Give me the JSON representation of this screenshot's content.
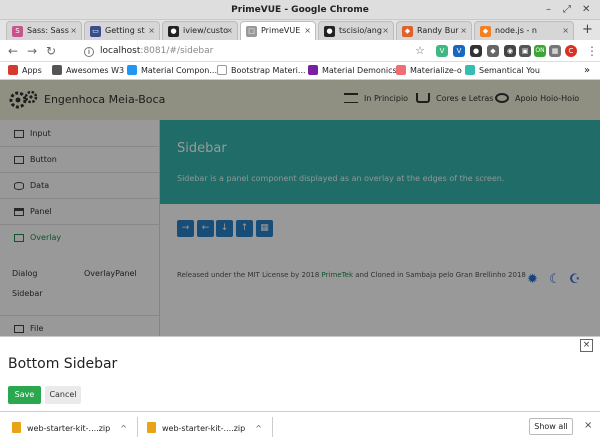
{
  "window": {
    "title": "PrimeVUE - Google Chrome",
    "minimize": "–",
    "maximize": "⤢",
    "close": "✕"
  },
  "tabs": [
    {
      "label": "Sass: Sass",
      "favicon_text": "S",
      "favicon_color": "#c6538c"
    },
    {
      "label": "Getting st",
      "favicon_text": "▭",
      "favicon_color": "#3b4c8a"
    },
    {
      "label": "iview/custo",
      "favicon_text": "●",
      "favicon_color": "#222222"
    },
    {
      "label": "PrimeVUE",
      "favicon_text": "□",
      "favicon_color": "#999999"
    },
    {
      "label": "tscisio/ang",
      "favicon_text": "●",
      "favicon_color": "#222222"
    },
    {
      "label": "Randy Bur",
      "favicon_text": "◆",
      "favicon_color": "#e0612b"
    },
    {
      "label": "node.js - n",
      "favicon_text": "◆",
      "favicon_color": "#f48024"
    }
  ],
  "tab_close": "×",
  "new_tab": "+",
  "toolbar": {
    "back": "←",
    "forward": "→",
    "reload": "↻",
    "url_host": "localhost",
    "url_rest": ":8081/#/sidebar",
    "star": "☆",
    "extensions": [
      {
        "name": "vue-devtools-icon",
        "text": "V",
        "color": "#41b883"
      },
      {
        "name": "vuetify-icon",
        "text": "V",
        "color": "#1867c0"
      },
      {
        "name": "github-ext-icon",
        "text": "●",
        "color": "#333333"
      },
      {
        "name": "puzzle-ext-icon",
        "text": "◆",
        "color": "#666666"
      },
      {
        "name": "circle-ext-icon",
        "text": "◉",
        "color": "#444444"
      },
      {
        "name": "camera-ext-icon",
        "text": "▣",
        "color": "#555555"
      },
      {
        "name": "green-ext-icon",
        "text": "ON",
        "color": "#3aa635"
      },
      {
        "name": "grid-ext-icon",
        "text": "▦",
        "color": "#777777"
      },
      {
        "name": "profile-avatar-icon",
        "text": "C",
        "color": "#d93025"
      }
    ],
    "menu": "⋮"
  },
  "bookmarks": [
    {
      "label": "Apps",
      "color": "#d33b2c"
    },
    {
      "label": "Awesomes W3",
      "color": "#555555"
    },
    {
      "label": "Material Compon...",
      "color": "#2196f3"
    },
    {
      "label": "Bootstrap Materi...",
      "color": "#cccccc"
    },
    {
      "label": "Material Demonics",
      "color": "#7b1fa2"
    },
    {
      "label": "Materialize-o",
      "color": "#ee6e73"
    },
    {
      "label": "Semantical You",
      "color": "#35bdb2"
    }
  ],
  "bookmarks_more": "»",
  "app": {
    "brand": "Engenhoca Meia-Boca",
    "menu": [
      "In Principio",
      "Cores e Letras",
      "Apoio Hoio-Hoio"
    ]
  },
  "sidemenu": {
    "items": [
      "Input",
      "Button",
      "Data",
      "Panel",
      "Overlay"
    ],
    "sub": [
      "Dialog",
      "OverlayPanel",
      "Sidebar"
    ],
    "file": "File"
  },
  "hero": {
    "title": "Sidebar",
    "desc": "Sidebar is a panel component displayed as an overlay at the edges of the screen."
  },
  "buttons": [
    "→",
    "←",
    "↓",
    "↑",
    "▦"
  ],
  "license": {
    "pre": "Released under the MIT License by 2018 ",
    "link": "PrimeTek",
    "post": " and Cloned in Sambaja pelo Gran Brellinho 2018"
  },
  "theme_icons": [
    "✹",
    "☾",
    "☪"
  ],
  "bottom_sidebar": {
    "close": "×",
    "title": "Bottom Sidebar",
    "save": "Save",
    "cancel": "Cancel"
  },
  "downloads": [
    {
      "label": "web-starter-kit-....zip",
      "chev": "^"
    },
    {
      "label": "web-starter-kit-....zip",
      "chev": "^"
    }
  ],
  "show_all": "Show all",
  "shelf_close": "×"
}
